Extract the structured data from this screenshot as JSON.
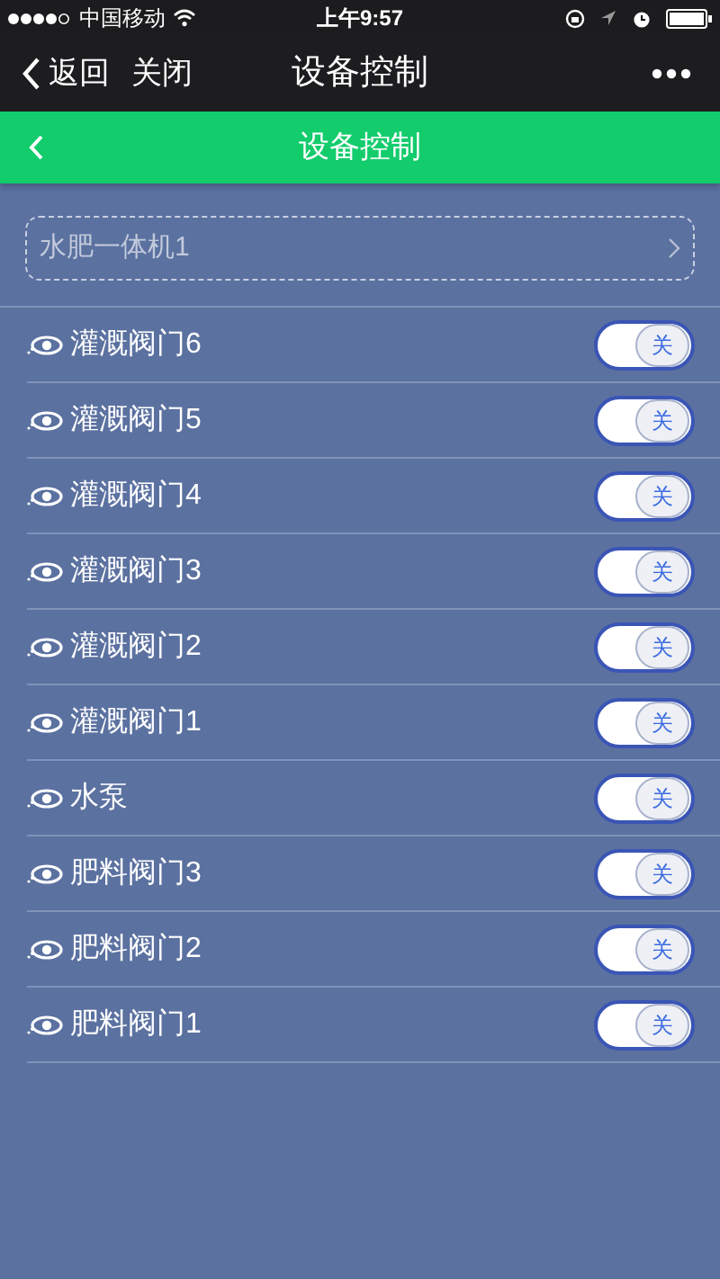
{
  "status_bar": {
    "carrier": "中国移动",
    "time": "上午9:57"
  },
  "nav_bar": {
    "back": "返回",
    "close": "关闭",
    "title": "设备控制"
  },
  "header": {
    "title": "设备控制"
  },
  "selector": {
    "value": "水肥一体机1"
  },
  "devices": [
    {
      "name": "灌溉阀门6",
      "on": false,
      "switch_label": "关"
    },
    {
      "name": "灌溉阀门5",
      "on": false,
      "switch_label": "关"
    },
    {
      "name": "灌溉阀门4",
      "on": false,
      "switch_label": "关"
    },
    {
      "name": "灌溉阀门3",
      "on": false,
      "switch_label": "关"
    },
    {
      "name": "灌溉阀门2",
      "on": false,
      "switch_label": "关"
    },
    {
      "name": "灌溉阀门1",
      "on": false,
      "switch_label": "关"
    },
    {
      "name": "水泵",
      "on": false,
      "switch_label": "关"
    },
    {
      "name": "肥料阀门3",
      "on": false,
      "switch_label": "关"
    },
    {
      "name": "肥料阀门2",
      "on": false,
      "switch_label": "关"
    },
    {
      "name": "肥料阀门1",
      "on": false,
      "switch_label": "关"
    }
  ]
}
